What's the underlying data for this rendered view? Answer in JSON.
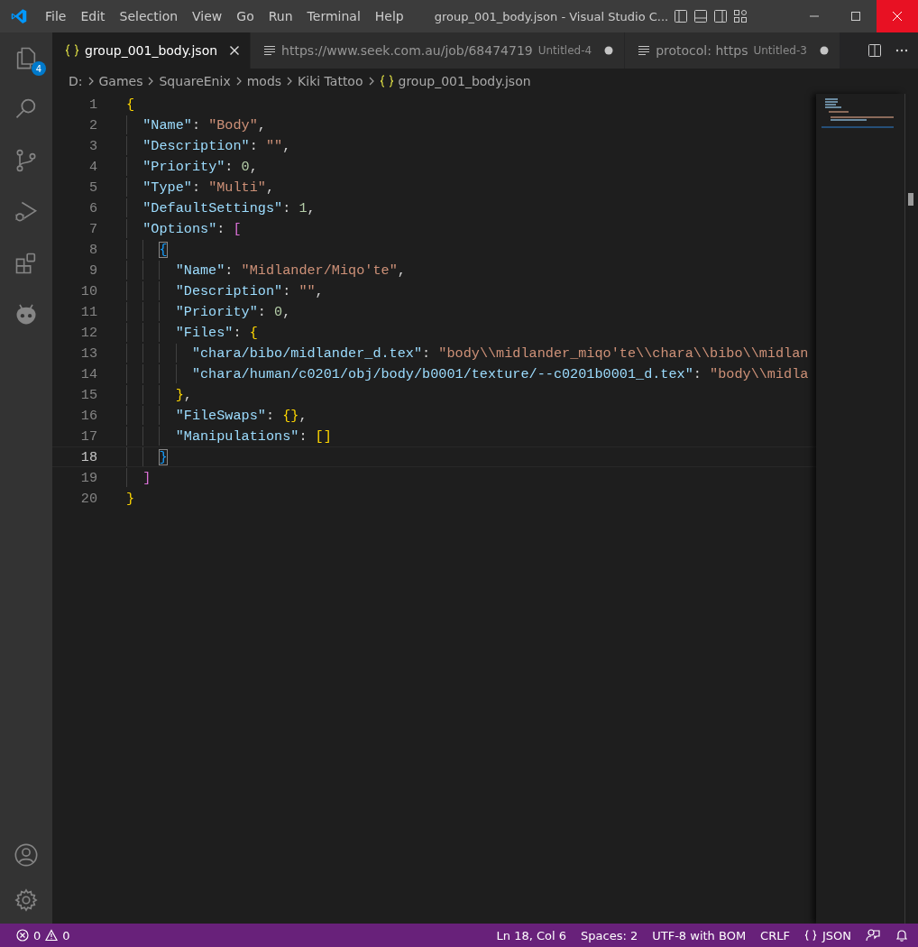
{
  "window": {
    "title": "group_001_body.json - Visual Studio C...",
    "menu": [
      "File",
      "Edit",
      "Selection",
      "View",
      "Go",
      "Run",
      "Terminal",
      "Help"
    ]
  },
  "activity_bar": {
    "explorer_badge": "4"
  },
  "tabs": [
    {
      "kind": "json",
      "label": "group_001_body.json",
      "dirty": false,
      "selected": true
    },
    {
      "kind": "text",
      "label": "https://www.seek.com.au/job/68474719",
      "description": "Untitled-4",
      "dirty": true,
      "selected": false
    },
    {
      "kind": "text",
      "label": "protocol: https",
      "description": "Untitled-3",
      "dirty": true,
      "selected": false
    }
  ],
  "breadcrumbs": [
    {
      "kind": "folder",
      "label": "D:"
    },
    {
      "kind": "folder",
      "label": "Games"
    },
    {
      "kind": "folder",
      "label": "SquareEnix"
    },
    {
      "kind": "folder",
      "label": "mods"
    },
    {
      "kind": "folder",
      "label": "Kiki Tattoo"
    },
    {
      "kind": "json",
      "label": "group_001_body.json"
    }
  ],
  "editor": {
    "lines": [
      {
        "number": "1",
        "current": false,
        "tokens": [
          {
            "kind": "open",
            "text": "{",
            "matched": false
          }
        ]
      },
      {
        "number": "2",
        "current": false,
        "tokens": [
          {
            "kind": "key",
            "text": "\"Name\""
          },
          {
            "kind": "punct",
            "text": ": "
          },
          {
            "kind": "str",
            "text": "\"Body\""
          },
          {
            "kind": "punct",
            "text": ","
          }
        ]
      },
      {
        "number": "3",
        "current": false,
        "tokens": [
          {
            "kind": "key",
            "text": "\"Description\""
          },
          {
            "kind": "punct",
            "text": ": "
          },
          {
            "kind": "str",
            "text": "\"\""
          },
          {
            "kind": "punct",
            "text": ","
          }
        ]
      },
      {
        "number": "4",
        "current": false,
        "tokens": [
          {
            "kind": "key",
            "text": "\"Priority\""
          },
          {
            "kind": "punct",
            "text": ": "
          },
          {
            "kind": "num",
            "text": "0"
          },
          {
            "kind": "punct",
            "text": ","
          }
        ]
      },
      {
        "number": "5",
        "current": false,
        "tokens": [
          {
            "kind": "key",
            "text": "\"Type\""
          },
          {
            "kind": "punct",
            "text": ": "
          },
          {
            "kind": "str",
            "text": "\"Multi\""
          },
          {
            "kind": "punct",
            "text": ","
          }
        ]
      },
      {
        "number": "6",
        "current": false,
        "tokens": [
          {
            "kind": "key",
            "text": "\"DefaultSettings\""
          },
          {
            "kind": "punct",
            "text": ": "
          },
          {
            "kind": "num",
            "text": "1"
          },
          {
            "kind": "punct",
            "text": ","
          }
        ]
      },
      {
        "number": "7",
        "current": false,
        "tokens": [
          {
            "kind": "key",
            "text": "\"Options\""
          },
          {
            "kind": "punct",
            "text": ": "
          },
          {
            "kind": "open",
            "text": "[",
            "matched": false
          }
        ]
      },
      {
        "number": "8",
        "current": false,
        "tokens": [
          {
            "kind": "open",
            "text": "{",
            "matched": true
          }
        ]
      },
      {
        "number": "9",
        "current": false,
        "tokens": [
          {
            "kind": "key",
            "text": "\"Name\""
          },
          {
            "kind": "punct",
            "text": ": "
          },
          {
            "kind": "str",
            "text": "\"Midlander/Miqo'te\""
          },
          {
            "kind": "punct",
            "text": ","
          }
        ]
      },
      {
        "number": "10",
        "current": false,
        "tokens": [
          {
            "kind": "key",
            "text": "\"Description\""
          },
          {
            "kind": "punct",
            "text": ": "
          },
          {
            "kind": "str",
            "text": "\"\""
          },
          {
            "kind": "punct",
            "text": ","
          }
        ]
      },
      {
        "number": "11",
        "current": false,
        "tokens": [
          {
            "kind": "key",
            "text": "\"Priority\""
          },
          {
            "kind": "punct",
            "text": ": "
          },
          {
            "kind": "num",
            "text": "0"
          },
          {
            "kind": "punct",
            "text": ","
          }
        ]
      },
      {
        "number": "12",
        "current": false,
        "tokens": [
          {
            "kind": "key",
            "text": "\"Files\""
          },
          {
            "kind": "punct",
            "text": ": "
          },
          {
            "kind": "open",
            "text": "{",
            "matched": false
          }
        ]
      },
      {
        "number": "13",
        "current": false,
        "tokens": [
          {
            "kind": "key",
            "text": "\"chara/bibo/midlander_d.tex\""
          },
          {
            "kind": "punct",
            "text": ": "
          },
          {
            "kind": "str",
            "text": "\"body\\\\midlander_miqo'te\\\\chara\\\\bibo\\\\midlan"
          }
        ]
      },
      {
        "number": "14",
        "current": false,
        "tokens": [
          {
            "kind": "key",
            "text": "\"chara/human/c0201/obj/body/b0001/texture/--c0201b0001_d.tex\""
          },
          {
            "kind": "punct",
            "text": ": "
          },
          {
            "kind": "str",
            "text": "\"body\\\\midla"
          }
        ]
      },
      {
        "number": "15",
        "current": false,
        "tokens": [
          {
            "kind": "close",
            "text": "}",
            "matched": false
          },
          {
            "kind": "punct",
            "text": ","
          }
        ]
      },
      {
        "number": "16",
        "current": false,
        "tokens": [
          {
            "kind": "key",
            "text": "\"FileSwaps\""
          },
          {
            "kind": "punct",
            "text": ": "
          },
          {
            "kind": "open",
            "text": "{",
            "matched": false
          },
          {
            "kind": "close",
            "text": "}",
            "matched": false
          },
          {
            "kind": "punct",
            "text": ","
          }
        ]
      },
      {
        "number": "17",
        "current": false,
        "tokens": [
          {
            "kind": "key",
            "text": "\"Manipulations\""
          },
          {
            "kind": "punct",
            "text": ": "
          },
          {
            "kind": "open",
            "text": "[",
            "matched": false
          },
          {
            "kind": "close",
            "text": "]",
            "matched": false
          }
        ]
      },
      {
        "number": "18",
        "current": true,
        "tokens": [
          {
            "kind": "close",
            "text": "}",
            "matched": true
          }
        ]
      },
      {
        "number": "19",
        "current": false,
        "tokens": [
          {
            "kind": "close",
            "text": "]",
            "matched": false
          }
        ]
      },
      {
        "number": "20",
        "current": false,
        "tokens": [
          {
            "kind": "close",
            "text": "}",
            "matched": false
          }
        ]
      }
    ]
  },
  "status_bar": {
    "errors": "0",
    "warnings": "0",
    "items": [
      "Ln 18, Col 6",
      "Spaces: 2",
      "UTF-8 with BOM",
      "CRLF"
    ],
    "language": "JSON"
  }
}
